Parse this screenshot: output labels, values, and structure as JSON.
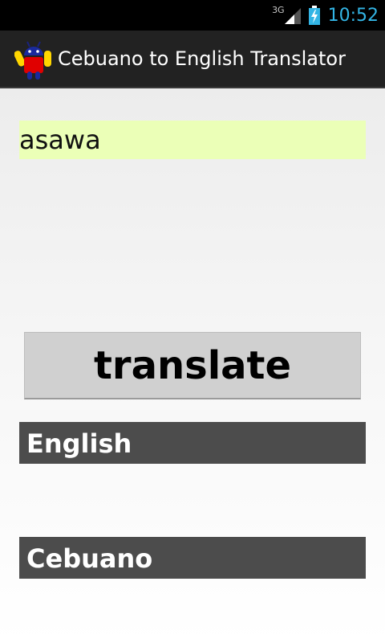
{
  "status_bar": {
    "network": "3G",
    "time": "10:52",
    "colors": {
      "time": "#33b5e5",
      "background": "#000000"
    }
  },
  "action_bar": {
    "title": "Cebuano to English Translator",
    "icon": "android-robot-icon"
  },
  "input": {
    "value": "asawa",
    "placeholder": "",
    "background_color": "#ebffb7"
  },
  "translate_button": {
    "label": "translate"
  },
  "sections": [
    {
      "label": "English",
      "result": ""
    },
    {
      "label": "Cebuano",
      "result": ""
    }
  ]
}
